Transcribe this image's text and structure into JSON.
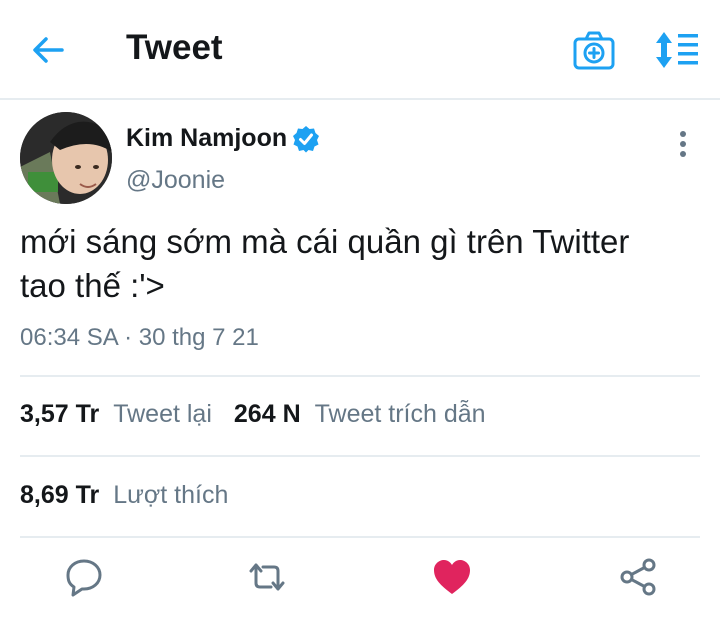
{
  "header": {
    "title": "Tweet",
    "back_icon": "arrow-left-icon",
    "camera_icon": "camera-plus-icon",
    "sort_icon": "sort-icon",
    "accent": "#1da1f2"
  },
  "tweet": {
    "author_name": "Kim Namjoon",
    "handle": "@Joonie",
    "verified": true,
    "text_line1": "mới sáng sớm mà cái quần gì trên Twitter",
    "text_line2": "tao thế :'>",
    "timestamp": "06:34 SA · 30 thg 7 21"
  },
  "stats": {
    "retweets_count": "3,57 Tr",
    "retweets_label": "Tweet lại",
    "quotes_count": "264 N",
    "quotes_label": "Tweet trích dẫn",
    "likes_count": "8,69 Tr",
    "likes_label": "Lượt thích"
  },
  "actions": {
    "reply_icon": "reply-icon",
    "retweet_icon": "retweet-icon",
    "like_icon": "heart-icon",
    "share_icon": "share-icon",
    "like_color": "#e0245e",
    "liked": true
  }
}
